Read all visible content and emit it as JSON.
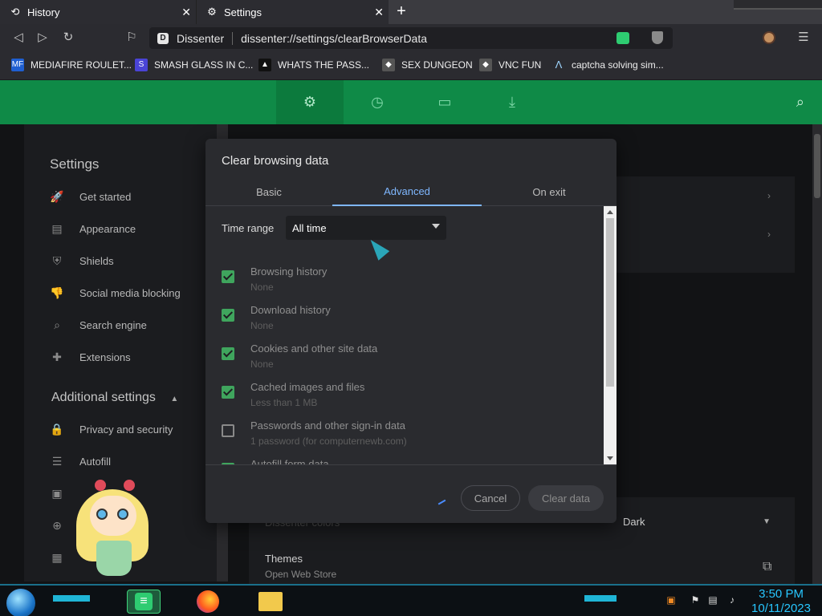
{
  "tabs": [
    {
      "title": "History",
      "icon": "history-icon"
    },
    {
      "title": "Settings",
      "icon": "gear-icon"
    }
  ],
  "toolbar": {
    "site_name": "Dissenter",
    "url": "dissenter://settings/clearBrowserData"
  },
  "bookmarks": [
    {
      "label": "MEDIAFIRE ROULET...",
      "icon_text": "MF",
      "color": "#1f5fd1"
    },
    {
      "label": "SMASH GLASS IN C...",
      "icon_text": "S",
      "color": "#4a44d6"
    },
    {
      "label": "WHATS THE PASS...",
      "icon_text": "▲",
      "color": "#222222"
    },
    {
      "label": "SEX DUNGEON",
      "icon_text": "◆",
      "color": "#444444"
    },
    {
      "label": "VNC FUN",
      "icon_text": "◆",
      "color": "#444444"
    },
    {
      "label": "captcha solving sim...",
      "icon_text": "Λ",
      "color": "#2b2b30"
    }
  ],
  "sidebar": {
    "title": "Settings",
    "items": [
      {
        "label": "Get started",
        "icon": "rocket-icon",
        "glyph": "🚀"
      },
      {
        "label": "Appearance",
        "icon": "keyboard-icon",
        "glyph": "▤"
      },
      {
        "label": "Shields",
        "icon": "shield-icon",
        "glyph": "⛨"
      },
      {
        "label": "Social media blocking",
        "icon": "thumb-icon",
        "glyph": "👎"
      },
      {
        "label": "Search engine",
        "icon": "search-icon",
        "glyph": "⌕"
      },
      {
        "label": "Extensions",
        "icon": "puzzle-icon",
        "glyph": "✚"
      }
    ],
    "additional_title": "Additional settings",
    "additional_items": [
      {
        "label": "Privacy and security",
        "icon": "lock-icon",
        "glyph": "🔒"
      },
      {
        "label": "Autofill",
        "icon": "list-icon",
        "glyph": "☰"
      }
    ]
  },
  "content": {
    "colors_label": "Dissenter colors",
    "colors_value": "Dark",
    "themes_label": "Themes",
    "themes_sub": "Open Web Store"
  },
  "dialog": {
    "title": "Clear browsing data",
    "tabs": [
      "Basic",
      "Advanced",
      "On exit"
    ],
    "active_tab": "Advanced",
    "time_range_label": "Time range",
    "time_range_value": "All time",
    "options": [
      {
        "label": "Browsing history",
        "sub": "None",
        "checked": true
      },
      {
        "label": "Download history",
        "sub": "None",
        "checked": true
      },
      {
        "label": "Cookies and other site data",
        "sub": "None",
        "checked": true
      },
      {
        "label": "Cached images and files",
        "sub": "Less than 1 MB",
        "checked": true
      },
      {
        "label": "Passwords and other sign-in data",
        "sub": "1 password (for computernewb.com)",
        "checked": false
      },
      {
        "label": "Autofill form data",
        "sub": "",
        "checked": true
      }
    ],
    "cancel_label": "Cancel",
    "clear_label": "Clear data"
  },
  "taskbar": {
    "time": "3:50 PM",
    "date": "10/11/2023"
  }
}
